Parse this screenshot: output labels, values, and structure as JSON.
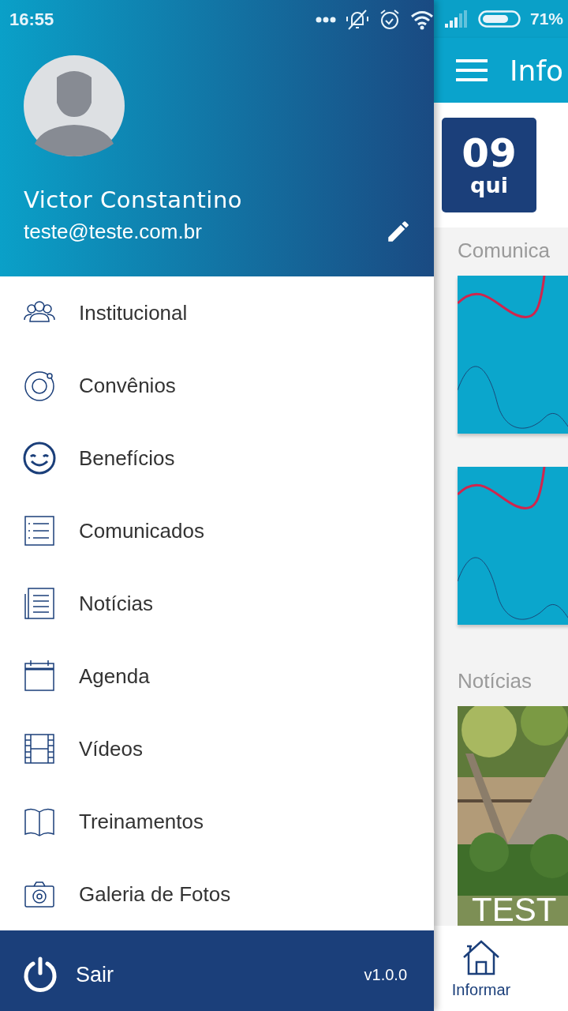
{
  "status_bar": {
    "time": "16:55",
    "battery": "71%"
  },
  "profile": {
    "name": "Victor Constantino",
    "email": "teste@teste.com.br"
  },
  "menu": [
    {
      "label": "Institucional"
    },
    {
      "label": "Convênios"
    },
    {
      "label": "Benefícios"
    },
    {
      "label": "Comunicados"
    },
    {
      "label": "Notícias"
    },
    {
      "label": "Agenda"
    },
    {
      "label": "Vídeos"
    },
    {
      "label": "Treinamentos"
    },
    {
      "label": "Galeria de Fotos"
    }
  ],
  "footer": {
    "label": "Sair",
    "version": "v1.0.0"
  },
  "main": {
    "title": "Info",
    "date": {
      "day": "09",
      "weekday": "qui"
    },
    "sections": [
      {
        "title": "Comunica",
        "cards": [
          {
            "kind": "wave"
          },
          {
            "kind": "wave"
          }
        ]
      },
      {
        "title": "Notícias",
        "cards": [
          {
            "kind": "picture",
            "caption": "TEST"
          }
        ]
      }
    ]
  },
  "bottom_nav": [
    {
      "label": "Informar"
    }
  ]
}
